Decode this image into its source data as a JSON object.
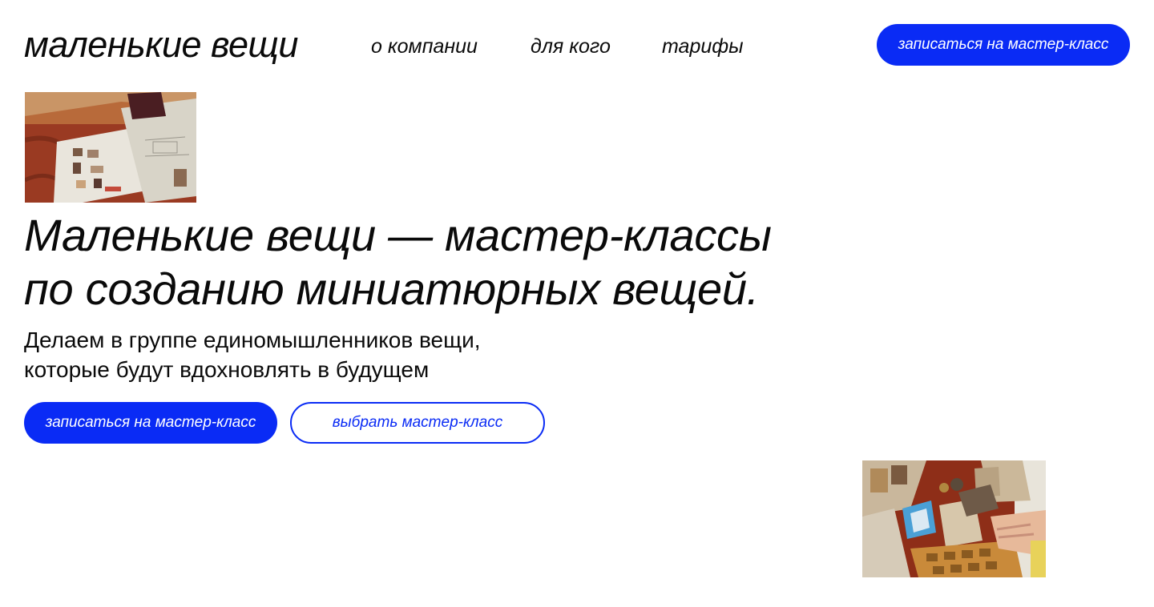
{
  "header": {
    "logo": "маленькие вещи",
    "nav": [
      {
        "label": "о компании"
      },
      {
        "label": "для кого"
      },
      {
        "label": "тарифы"
      }
    ],
    "cta_label": "записаться на мастер-класс"
  },
  "hero": {
    "title_lines": [
      "Маленькие вещи — мастер-классы",
      "по созданию миниатюрных вещей."
    ],
    "subtitle_lines": [
      "Делаем в группе единомышленников вещи,",
      "которые будут вдохновлять в будущем"
    ],
    "primary_button": "записаться на мастер-класс",
    "secondary_button": "выбрать мастер-класс"
  },
  "colors": {
    "accent": "#0a2bf5",
    "text": "#0a0a0a",
    "background": "#ffffff"
  },
  "images": {
    "top": "photo-design-sketches",
    "bottom": "photo-material-samples"
  }
}
